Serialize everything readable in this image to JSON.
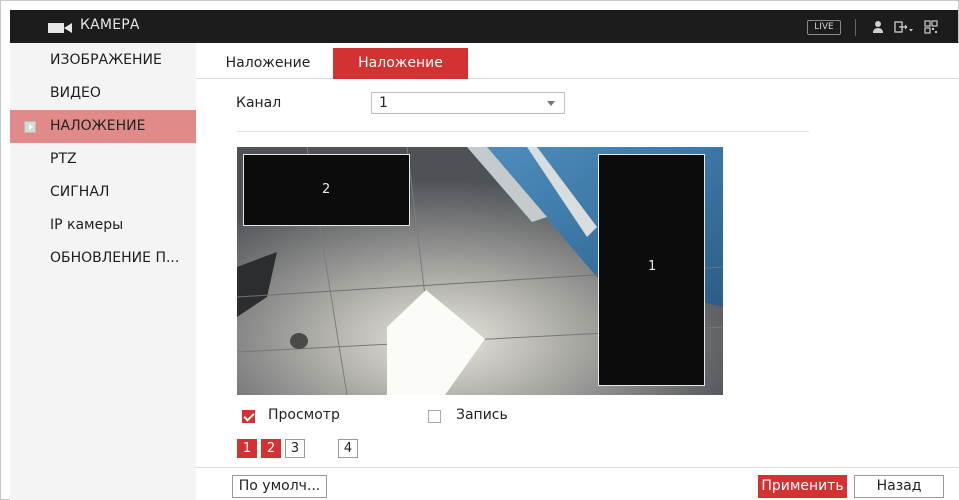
{
  "topbar": {
    "title": "КАМЕРА",
    "live_label": "LIVE",
    "icons": [
      "camera-icon",
      "user-icon",
      "logout-icon",
      "qr-code-icon"
    ]
  },
  "sidebar": {
    "items": [
      {
        "label": "ИЗОБРАЖЕНИЕ",
        "active": false
      },
      {
        "label": "ВИДЕО",
        "active": false
      },
      {
        "label": "НАЛОЖЕНИЕ",
        "active": true
      },
      {
        "label": "PTZ",
        "active": false
      },
      {
        "label": "СИГНАЛ",
        "active": false
      },
      {
        "label": "IP камеры",
        "active": false
      },
      {
        "label": "ОБНОВЛЕНИЕ П...",
        "active": false
      }
    ]
  },
  "tabs": [
    {
      "label": "Наложение",
      "active": false
    },
    {
      "label": "Наложение",
      "active": true
    }
  ],
  "channel": {
    "label": "Канал",
    "value": "1"
  },
  "preview": {
    "masks": [
      {
        "label": "2"
      },
      {
        "label": "1"
      }
    ]
  },
  "options": {
    "preview_label": "Просмотр",
    "preview_checked": true,
    "record_label": "Запись",
    "record_checked": false
  },
  "regions": [
    {
      "label": "1",
      "on": true
    },
    {
      "label": "2",
      "on": true
    },
    {
      "label": "3",
      "on": false
    },
    {
      "label": "4",
      "on": false
    }
  ],
  "footer": {
    "default_label": "По умолч...",
    "apply_label": "Применить",
    "back_label": "Назад"
  },
  "colors": {
    "accent": "#d33232",
    "sidebar_active": "#e08a8a",
    "topbar": "#1c1c1c"
  }
}
